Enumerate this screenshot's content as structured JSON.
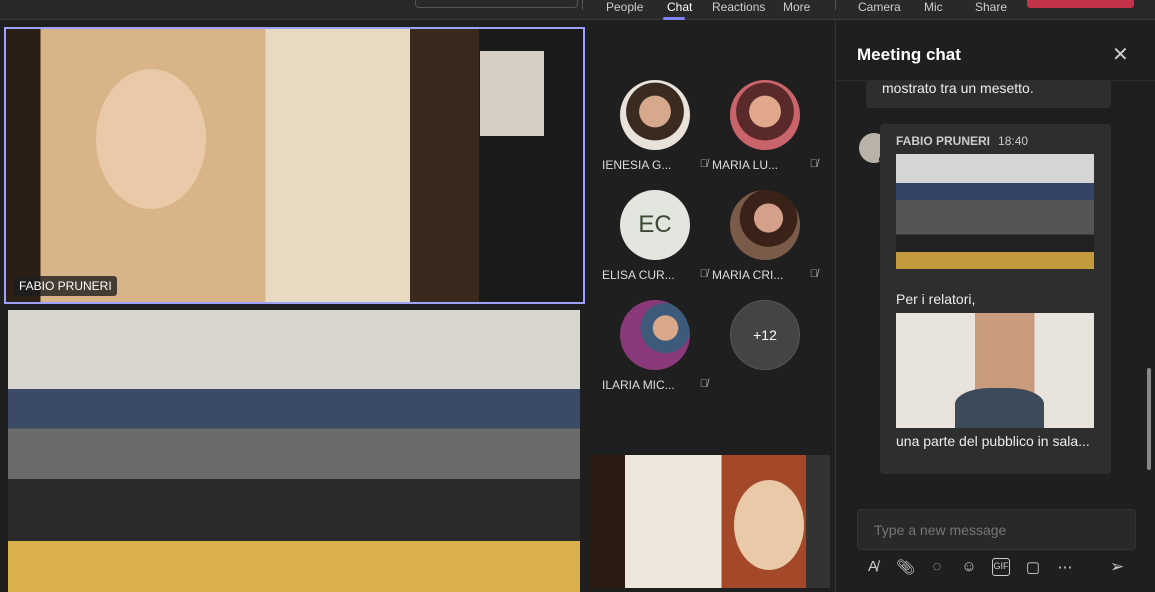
{
  "toolbar": {
    "items": [
      {
        "label": "People"
      },
      {
        "label": "Chat",
        "active": true
      },
      {
        "label": "Reactions"
      },
      {
        "label": "More"
      },
      {
        "label": "Camera"
      },
      {
        "label": "Mic"
      },
      {
        "label": "Share"
      }
    ],
    "accent": "#7f85f5",
    "leave_color": "#c4314b"
  },
  "stage": {
    "speaker_name": "FABIO PRUNERI"
  },
  "participants": [
    {
      "name": "IENESIA G...",
      "muted": true,
      "avatar": "photo"
    },
    {
      "name": "MARIA LU...",
      "muted": true,
      "avatar": "photo"
    },
    {
      "name": "ELISA CUR...",
      "muted": true,
      "initials": "EC"
    },
    {
      "name": "MARIA CRI...",
      "muted": true,
      "avatar": "photo"
    },
    {
      "name": "ILARIA MIC...",
      "muted": true,
      "avatar": "photo"
    }
  ],
  "overflow": {
    "label": "+12"
  },
  "chat": {
    "title": "Meeting chat",
    "prev_message": "mostrato tra un mesetto.",
    "message": {
      "author": "FABIO PRUNERI",
      "time": "18:40",
      "text1": "Per i relatori,",
      "text2": "una parte del pubblico in sala..."
    },
    "compose_placeholder": "Type a new message",
    "tools": [
      "format-icon",
      "attach-icon",
      "loop-icon",
      "emoji-icon",
      "gif-icon",
      "sticker-icon",
      "more-icon"
    ]
  }
}
